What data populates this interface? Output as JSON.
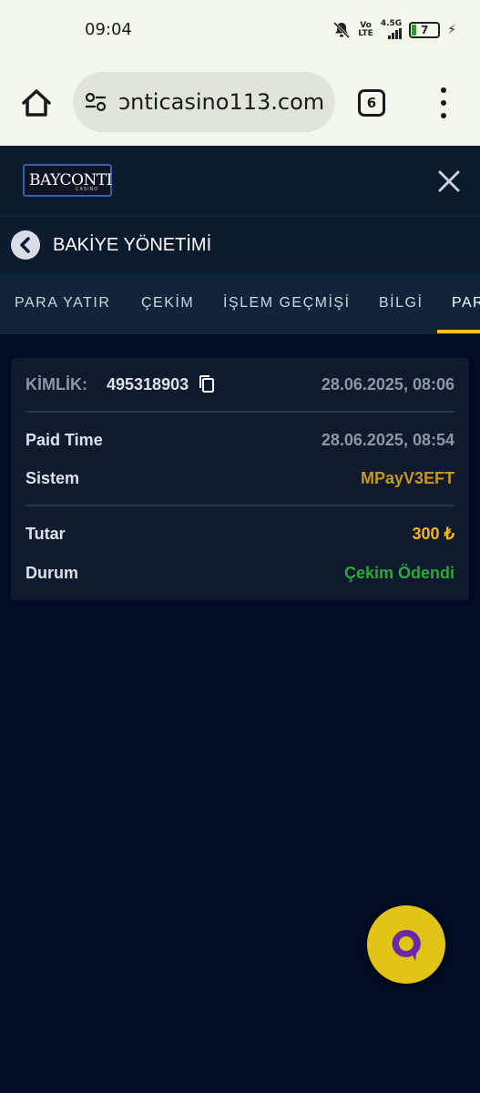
{
  "status_bar": {
    "time": "09:04",
    "network_label_top": "Vo",
    "network_label_bottom": "LTE",
    "network_type": "4.5G",
    "battery": "7",
    "icons": [
      "bell-muted-icon",
      "signal-icon",
      "battery-icon",
      "charging-bolt-icon"
    ]
  },
  "browser": {
    "url": "ɔnticasino113.com",
    "tab_count": "6",
    "icons": [
      "home-icon",
      "site-settings-icon",
      "menu-dots-icon"
    ]
  },
  "header": {
    "logo_text": "BAYCONTI",
    "logo_sub": "CASINO",
    "icons": [
      "close-icon"
    ]
  },
  "page": {
    "title": "BAKİYE YÖNETİMİ",
    "icons": [
      "back-arrow-icon"
    ]
  },
  "tabs": [
    {
      "label": "PARA YATIR"
    },
    {
      "label": "ÇEKİM"
    },
    {
      "label": "İŞLEM GEÇMİŞİ"
    },
    {
      "label": "BİLGİ"
    },
    {
      "label": "PAR"
    }
  ],
  "transaction": {
    "id_label": "KİMLİK:",
    "id_value": "495318903",
    "created": "28.06.2025, 08:06",
    "paid_time_label": "Paid Time",
    "paid_time_value": "28.06.2025, 08:54",
    "system_label": "Sistem",
    "system_value": "MPayV3EFT",
    "amount_label": "Tutar",
    "amount_value": "300 ₺",
    "status_label": "Durum",
    "status_value": "Çekim Ödendi"
  },
  "colors": {
    "background": "#000c22",
    "card": "#101a2e",
    "accent_yellow": "#f0c419",
    "system_gold": "#c9961b",
    "amount_yellow": "#f2b51d",
    "status_green": "#2ea83a"
  }
}
